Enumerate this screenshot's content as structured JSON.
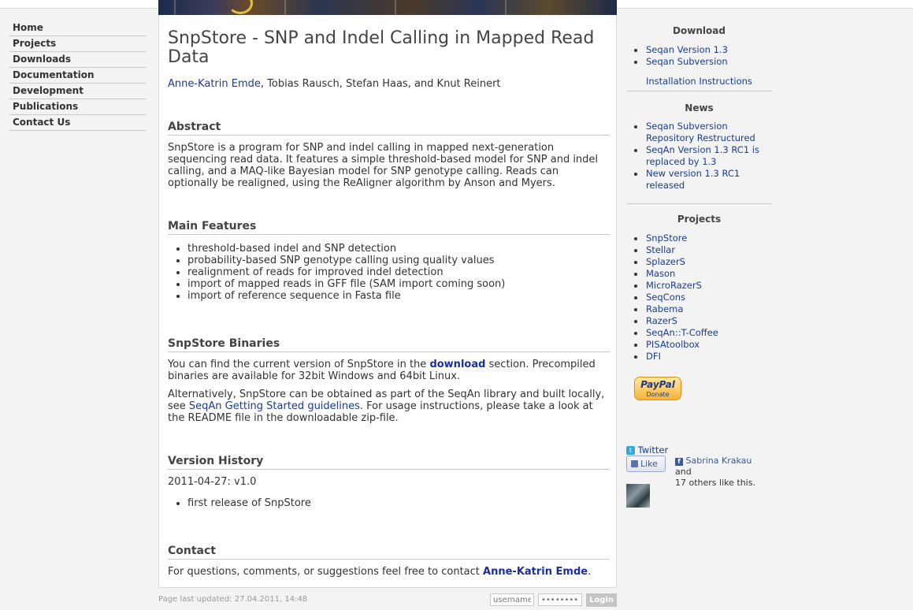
{
  "nav": {
    "items": [
      "Home",
      "Projects",
      "Downloads",
      "Documentation",
      "Development",
      "Publications",
      "Contact Us"
    ]
  },
  "main": {
    "title": "SnpStore - SNP and Indel Calling in Mapped Read Data",
    "authors": {
      "link_name": "Anne-Katrin Emde",
      "rest": ", Tobias Rausch, Stefan Haas, and Knut Reinert"
    },
    "abstract": {
      "heading": "Abstract",
      "text": "SnpStore is a program for SNP and indel calling in mapped next-generation sequencing read data. It features a simple threshold-based model for SNP and indel calling, and a MAQ-like Bayesian model for SNP genotype calling. Reads can optionally be realigned, using the ReAligner algorithm by Anson and Myers."
    },
    "features": {
      "heading": "Main Features",
      "items": [
        "threshold-based indel and SNP detection",
        "probability-based SNP genotype calling using quality values",
        "realignment of reads for improved indel detection",
        "import of mapped reads in GFF file (SAM import coming soon)",
        "import of reference sequence in Fasta file"
      ]
    },
    "binaries": {
      "heading": "SnpStore Binaries",
      "p1_pre": "You can find the current version of SnpStore in the ",
      "p1_link": "download",
      "p1_post": " section. Precompiled binaries are available for 32bit Windows and 64bit Linux.",
      "p2_pre": "Alternatively, SnpStore can be obtained as part of the SeqAn library and built locally, see ",
      "p2_link": "SeqAn Getting Started guidelines",
      "p2_post": ". For usage instructions, please take a look at the README file in the downloadable zip-file."
    },
    "history": {
      "heading": "Version History",
      "entry": "2011-04-27: v1.0",
      "items": [
        "first release of SnpStore"
      ]
    },
    "contact": {
      "heading": "Contact",
      "pre": "For questions, comments, or suggestions feel free to contact ",
      "link": "Anne-Katrin Emde",
      "post": "."
    }
  },
  "sidebar": {
    "download": {
      "heading": "Download",
      "items": [
        "Seqan Version 1.3",
        "Seqan Subversion"
      ],
      "install": "Installation Instructions"
    },
    "news": {
      "heading": "News",
      "items": [
        "Seqan Subversion Repository Restructured",
        "SeqAn Version 1.3 RC1 is replaced by 1.3",
        "New version 1.3 RC1 released"
      ]
    },
    "projects": {
      "heading": "Projects",
      "items": [
        "SnpStore",
        "Stellar",
        "SplazerS",
        "Mason",
        "MicroRazerS",
        "SeqCons",
        "Rabema",
        "RazerS",
        "SeqAn::T-Coffee",
        "PISAtoolbox",
        "DFI"
      ]
    },
    "paypal": {
      "logo": "PayPal",
      "label": "Donate"
    },
    "twitter": "Twitter",
    "facebook": {
      "like": "Like",
      "name": "Sabrina Krakau",
      "rest1": " and",
      "rest2": "17 others like this."
    }
  },
  "footer": {
    "updated": "Page last updated: 27.04.2011, 14:48",
    "username_placeholder": "username",
    "password_placeholder": "••••••••",
    "login": "Login"
  },
  "colors": {
    "link": "#1a3d8f",
    "background": "#f3f3f3",
    "paypal": "#f7b233"
  }
}
